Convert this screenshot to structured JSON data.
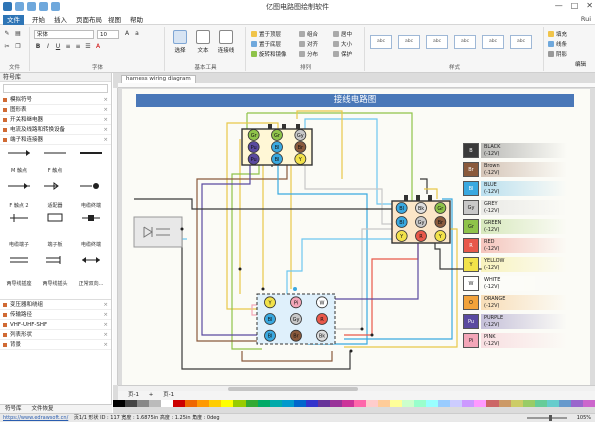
{
  "app": {
    "title": "亿图电路图绘制软件",
    "window_controls": [
      "—",
      "□",
      "✕"
    ]
  },
  "menu": {
    "items": [
      "文件",
      "开始",
      "插入",
      "页面布局",
      "视图",
      "帮助"
    ],
    "user": "Rui"
  },
  "ribbon": {
    "font_family": "宋体",
    "font_size": "10",
    "groups": [
      "文件",
      "字体",
      "基本工具",
      "排列",
      "样式"
    ],
    "tools": {
      "select": "选择",
      "text": "文本",
      "connector": "连接线"
    },
    "arrange": [
      "置于顶层",
      "置于底层",
      "旋转和镜像",
      "组合",
      "对齐",
      "分布",
      "居中",
      "大小",
      "保护"
    ],
    "style_items": [
      "abc",
      "abc",
      "abc",
      "abc",
      "abc",
      "abc"
    ],
    "right": [
      "填充",
      "线条",
      "阴影"
    ],
    "edit": "编辑"
  },
  "left_panel": {
    "header": "符号库",
    "categories_top": [
      "模拟符号",
      "图形表",
      "开关和继电器",
      "电流及线路和转换设备",
      "端子和连接器"
    ],
    "symbols": [
      [
        "",
        "",
        ""
      ],
      [
        "M 触点",
        "F 触点",
        ""
      ],
      [
        "",
        "",
        ""
      ],
      [
        "F 触点 2",
        "适配器",
        "电缆终端"
      ],
      [
        "",
        "",
        ""
      ],
      [
        "电缆端子",
        "端子板",
        "电缆终端"
      ],
      [
        "",
        "",
        ""
      ],
      [
        "两导线插座",
        "两导线插头",
        "正常双向..."
      ]
    ],
    "categories_bottom": [
      "变压器和绕组",
      "传输路径",
      "VHF-UHF-SHF",
      "列表形状",
      "背景"
    ],
    "bottom_tabs": [
      "符号库",
      "文件恢复"
    ]
  },
  "canvas": {
    "doc_tab": "harness wiring diagram",
    "page_tab": "页-1",
    "page_tab2": "页-1",
    "drawing_title": "接线电路图"
  },
  "connectors": {
    "top": [
      "Gr",
      "Gr",
      "Gy",
      "Pu",
      "Bl",
      "Br",
      "Pu",
      "Bl",
      "Y"
    ],
    "right": [
      "Bl",
      "Bk",
      "Gr",
      "Bl",
      "Gy",
      "Br",
      "Y",
      "R",
      "Y"
    ],
    "bottom": [
      "Y",
      "Pi",
      "W",
      "Bl",
      "Gy",
      "R",
      "Bl",
      "Br",
      "Bk"
    ]
  },
  "legend": [
    {
      "code": "B",
      "name": "BLACK",
      "voltage": "(-12V)",
      "color": "#3a3a3a",
      "text": "#ffffff"
    },
    {
      "code": "Br",
      "name": "Brown",
      "voltage": "(-12V)",
      "color": "#8a5a3c",
      "text": "#ffffff"
    },
    {
      "code": "Bl",
      "name": "BLUE",
      "voltage": "(-12V)",
      "color": "#3aa9e0",
      "text": "#ffffff"
    },
    {
      "code": "Gy",
      "name": "GREY",
      "voltage": "(-12V)",
      "color": "#c8c8c8",
      "text": "#222222"
    },
    {
      "code": "Gr",
      "name": "GREEN",
      "voltage": "(-12V)",
      "color": "#8fc34a",
      "text": "#222222"
    },
    {
      "code": "R",
      "name": "RED",
      "voltage": "(-12V)",
      "color": "#e8584a",
      "text": "#ffffff"
    },
    {
      "code": "Y",
      "name": "YELLOW",
      "voltage": "(-12V)",
      "color": "#f2e24a",
      "text": "#222222"
    },
    {
      "code": "W",
      "name": "WHITE",
      "voltage": "(-12V)",
      "color": "#ffffff",
      "text": "#222222"
    },
    {
      "code": "O",
      "name": "ORANGE",
      "voltage": "(-12V)",
      "color": "#f2a23a",
      "text": "#222222"
    },
    {
      "code": "Pu",
      "name": "PURPLE",
      "voltage": "(-12V)",
      "color": "#5a4aa0",
      "text": "#ffffff"
    },
    {
      "code": "Pi",
      "name": "PINK",
      "voltage": "(-12V)",
      "color": "#f3a6b8",
      "text": "#222222"
    }
  ],
  "status": {
    "link": "https://www.edrawsoft.cn/",
    "text": "页1/1  形状 ID : 117  宽度 : 1.6875in  高度 : 1.25in  角度 : 0deg",
    "zoom": "105%"
  }
}
